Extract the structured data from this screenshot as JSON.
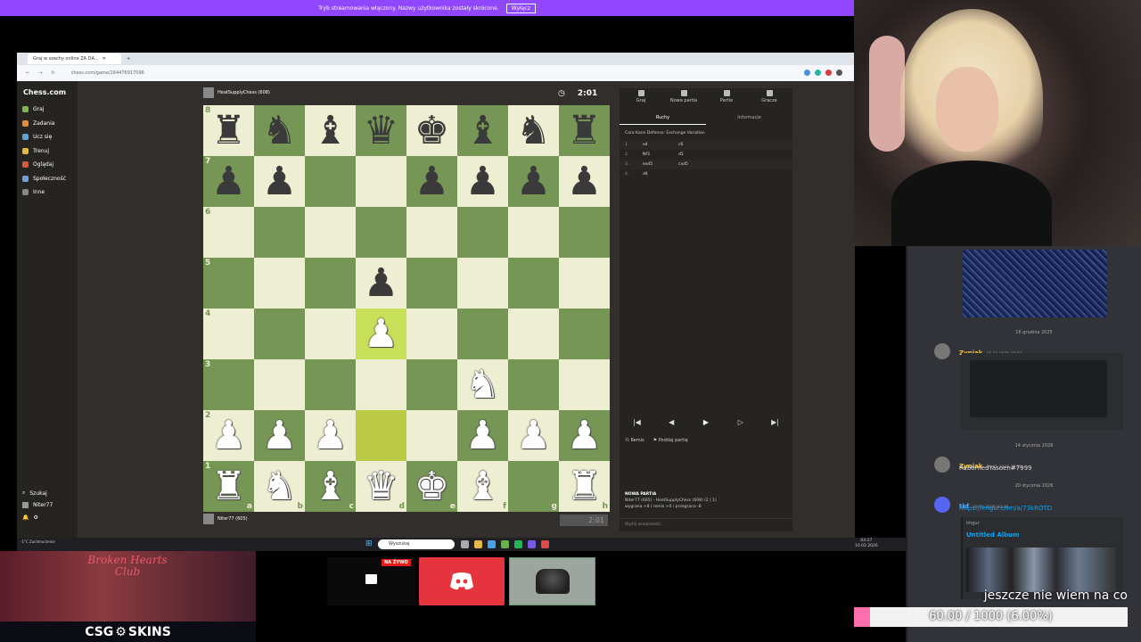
{
  "banner": {
    "text": "Tryb streamowania włączony. Nazwy użytkownika zostały skrócone.",
    "button": "Wyłącz"
  },
  "browser": {
    "tab_title": "Graj w szachy online ZA DA...",
    "url": "chess.com/game/164476917096"
  },
  "chess": {
    "logo": "Chess.com",
    "nav": [
      "Graj",
      "Zadania",
      "Ucz się",
      "Trenuj",
      "Oglądaj",
      "Społeczność",
      "Inne"
    ],
    "nav_colors": [
      "#81b64c",
      "#e88b3a",
      "#5aa6d6",
      "#e5b93d",
      "#d9573c",
      "#6fa0d8",
      "#888888"
    ],
    "search": "Szukaj",
    "user": "Niter77",
    "top_player": "HeatSupplyChess (608)",
    "bottom_player": "Niter77 (605)",
    "clock_top": "2:01",
    "clock_bottom": "2:01",
    "board": [
      [
        "r",
        "n",
        "b",
        "q",
        "k",
        "b",
        "n",
        "r"
      ],
      [
        "p",
        "p",
        "",
        "",
        "p",
        "p",
        "p",
        "p"
      ],
      [
        "",
        "",
        "",
        "",
        "",
        "",
        "",
        ""
      ],
      [
        "",
        "",
        "",
        "p",
        "",
        "",
        "",
        ""
      ],
      [
        "",
        "",
        "",
        "P",
        "",
        "",
        "",
        ""
      ],
      [
        "",
        "",
        "",
        "",
        "",
        "N",
        "",
        ""
      ],
      [
        "P",
        "P",
        "P",
        "",
        "",
        "P",
        "P",
        "P"
      ],
      [
        "R",
        "N",
        "B",
        "Q",
        "K",
        "B",
        "",
        "R"
      ]
    ],
    "highlights": [
      [
        4,
        3
      ],
      [
        6,
        3
      ]
    ],
    "ranks": [
      "8",
      "7",
      "6",
      "5",
      "4",
      "3",
      "2",
      "1"
    ],
    "files": [
      "a",
      "b",
      "c",
      "d",
      "e",
      "f",
      "g",
      "h"
    ]
  },
  "panel": {
    "tabs": [
      "Graj",
      "Nowa partia",
      "Partie",
      "Gracze"
    ],
    "subtabs": [
      "Ruchy",
      "Informacje"
    ],
    "opening": "Caro-Kann Defense: Exchange Variation",
    "moves": [
      {
        "n": "1.",
        "w": "e4",
        "b": "c6"
      },
      {
        "n": "2.",
        "w": "Nf3",
        "b": "d5"
      },
      {
        "n": "3.",
        "w": "exd5",
        "b": "cxd5"
      },
      {
        "n": "4.",
        "w": "d4",
        "b": ""
      }
    ],
    "controls": [
      "|◀",
      "◀",
      "▶",
      "▷",
      "▶|"
    ],
    "draw": "Remis",
    "resign": "Poddaj partię",
    "new_game_title": "NOWA PARTIA",
    "new_game_line1": "Niter77 (605) - HeatSupplyChess (608) (2 | 1)",
    "new_game_line2": "wygrana +8 / remis +0 / przegrana -8",
    "chat_placeholder": "Wyślij wiadomość..."
  },
  "taskbar": {
    "search": "Wyszukaj",
    "time": "04:27",
    "date": "10.02.2026",
    "weather": "-1°C Zachmurzenie"
  },
  "discord": {
    "date1": "16 grudnia 2025",
    "msg1": {
      "name": "Zyniak",
      "time": "16.12.2025 18:52"
    },
    "date2": "14 stycznia 2026",
    "msg2": {
      "name": "Zyniak",
      "time": "14.01.2026 23:53",
      "text": "RebornedYasoen#7999"
    },
    "date3": "20 stycznia 2026",
    "msg3": {
      "name": "tkf",
      "time": "20.01.2026 03:46",
      "text": "https://imgur.com/a/73kROTD"
    },
    "embed_site": "imgur",
    "embed_title": "Untitled Album"
  },
  "overlays": {
    "ad_title": "Broken Hearts Club",
    "ad_brand_left": "CSG",
    "ad_brand_right": "SKINS",
    "live_badge": "NA ŻYWO",
    "goal_text": "jeszcze nie wiem na co",
    "goal_value": "60.00 / 1000 (6.00%)",
    "goal_fraction": 0.06
  },
  "colors": {
    "board_light": "#eeeed2",
    "board_dark": "#769656",
    "banner": "#9147ff",
    "discord_red": "#e6343f",
    "goal_pink": "#ff6fae"
  }
}
